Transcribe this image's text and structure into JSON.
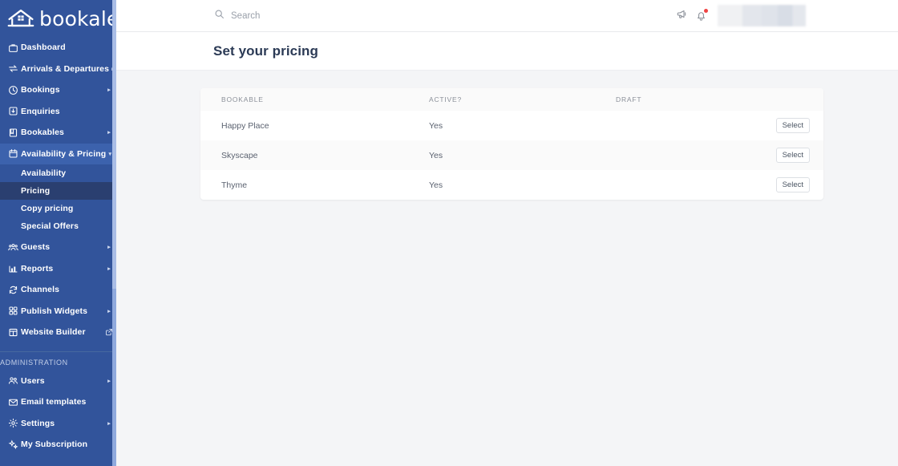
{
  "brand": {
    "name": "bookalet",
    "logo_icon": "house-icon",
    "sidebar_color": "#32549b",
    "active_color": "#2a3f70",
    "highlight_color": "#3c62ad"
  },
  "sidebar": {
    "items": [
      {
        "label": "Dashboard",
        "icon": "briefcase-icon",
        "caret": "",
        "state": ""
      },
      {
        "label": "Arrivals & Departures",
        "icon": "exchange-arrows-icon",
        "caret": "▸",
        "state": ""
      },
      {
        "label": "Bookings",
        "icon": "clock-icon",
        "caret": "▸",
        "state": ""
      },
      {
        "label": "Enquiries",
        "icon": "inbox-download-icon",
        "caret": "",
        "state": ""
      },
      {
        "label": "Bookables",
        "icon": "book-icon",
        "caret": "▸",
        "state": ""
      },
      {
        "label": "Availability & Pricing",
        "icon": "calendar-icon",
        "caret": "▾",
        "state": "highlight"
      }
    ],
    "submenu": [
      {
        "label": "Availability",
        "state": ""
      },
      {
        "label": "Pricing",
        "state": "active"
      },
      {
        "label": "Copy pricing",
        "state": ""
      },
      {
        "label": "Special Offers",
        "state": ""
      }
    ],
    "items_after": [
      {
        "label": "Guests",
        "icon": "people-group-icon",
        "caret": "▸",
        "state": ""
      },
      {
        "label": "Reports",
        "icon": "bar-chart-icon",
        "caret": "▸",
        "state": ""
      },
      {
        "label": "Channels",
        "icon": "refresh-sync-icon",
        "caret": "",
        "state": ""
      },
      {
        "label": "Publish Widgets",
        "icon": "grid-squares-icon",
        "caret": "▸",
        "state": ""
      },
      {
        "label": "Website Builder",
        "icon": "layout-icon",
        "caret": "",
        "state": "",
        "external": true
      }
    ],
    "section_label": "ADMINISTRATION",
    "admin_items": [
      {
        "label": "Users",
        "icon": "users-icon",
        "caret": "▸",
        "state": ""
      },
      {
        "label": "Email templates",
        "icon": "envelope-icon",
        "caret": "",
        "state": ""
      },
      {
        "label": "Settings",
        "icon": "gear-icon",
        "caret": "▸",
        "state": ""
      },
      {
        "label": "My Subscription",
        "icon": "sparkle-icon",
        "caret": "",
        "state": ""
      }
    ]
  },
  "topbar": {
    "search_placeholder": "Search",
    "search_value": "",
    "search_icon": "search-icon",
    "megaphone_icon": "megaphone-icon",
    "bell_icon": "bell-icon",
    "notification_dot": true,
    "account_area": "redacted-account-block"
  },
  "page": {
    "title": "Set your pricing"
  },
  "table": {
    "columns": [
      "BOOKABLE",
      "ACTIVE?",
      "DRAFT",
      ""
    ],
    "rows": [
      {
        "bookable": "Happy Place",
        "active": "Yes",
        "draft": "",
        "action": "Select"
      },
      {
        "bookable": "Skyscape",
        "active": "Yes",
        "draft": "",
        "action": "Select"
      },
      {
        "bookable": "Thyme",
        "active": "Yes",
        "draft": "",
        "action": "Select"
      }
    ]
  }
}
